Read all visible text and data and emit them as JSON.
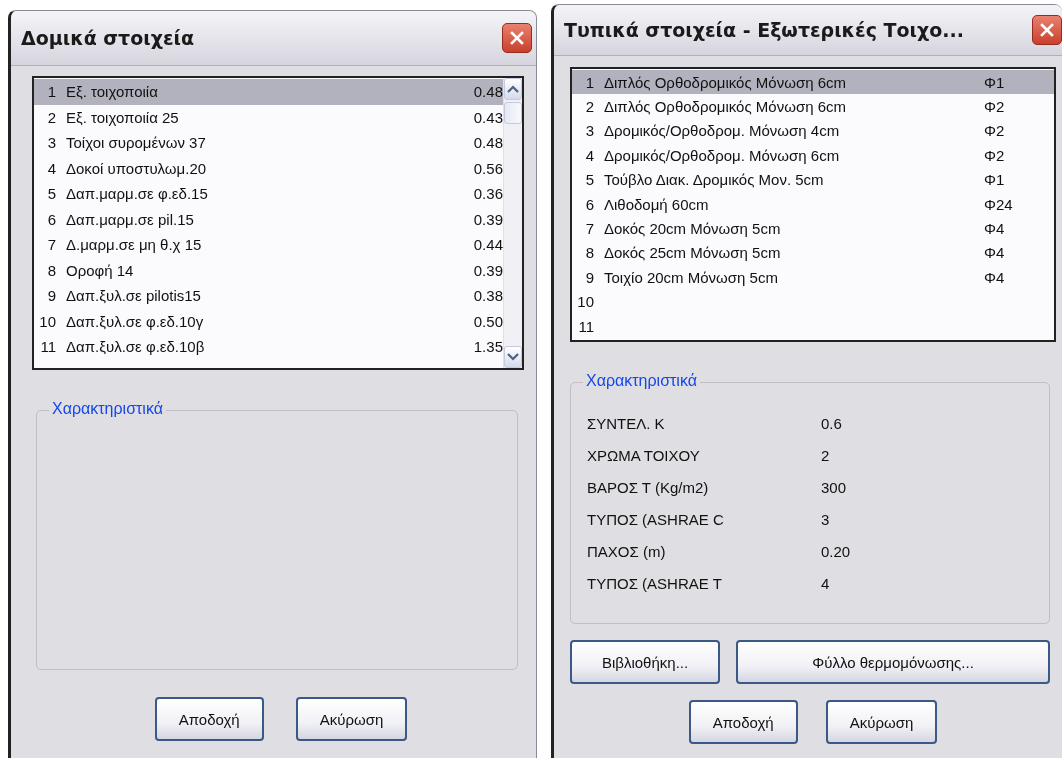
{
  "dialogs": [
    {
      "title": "Δομικά στοιχεία",
      "list": {
        "scrollbar": true,
        "rows": [
          {
            "number": "1",
            "name": "Εξ. τοιχοποιία",
            "value": "0.48",
            "selected": true
          },
          {
            "number": "2",
            "name": "Εξ. τοιχοποιία 25",
            "value": "0.43",
            "selected": false
          },
          {
            "number": "3",
            "name": "Τοίχοι συρομένων 37",
            "value": "0.48",
            "selected": false
          },
          {
            "number": "4",
            "name": "Δοκοί υποστυλωμ.20",
            "value": "0.56",
            "selected": false
          },
          {
            "number": "5",
            "name": "Δαπ.μαρμ.σε φ.εδ.15",
            "value": "0.36",
            "selected": false
          },
          {
            "number": "6",
            "name": "Δαπ.μαρμ.σε pil.15",
            "value": "0.39",
            "selected": false
          },
          {
            "number": "7",
            "name": "Δ.μαρμ.σε μη θ.χ 15",
            "value": "0.44",
            "selected": false
          },
          {
            "number": "8",
            "name": "Οροφή 14",
            "value": "0.39",
            "selected": false
          },
          {
            "number": "9",
            "name": "Δαπ.ξυλ.σε pilotis15",
            "value": "0.38",
            "selected": false
          },
          {
            "number": "10",
            "name": "Δαπ.ξυλ.σε φ.εδ.10γ",
            "value": "0.50",
            "selected": false
          },
          {
            "number": "11",
            "name": "Δαπ.ξυλ.σε φ.εδ.10β",
            "value": "1.35",
            "selected": false
          }
        ]
      },
      "characteristics": {
        "label": "Χαρακτηριστικά"
      },
      "button_rows": [
        [
          "Αποδοχή",
          "Ακύρωση"
        ]
      ]
    },
    {
      "title": "Τυπικά στοιχεία - Εξωτερικές Τοιχο...",
      "list": {
        "scrollbar": false,
        "rows": [
          {
            "number": "1",
            "name": "Διπλός Ορθοδρομικός Μόνωση 6cm",
            "value": "Φ1",
            "selected": true
          },
          {
            "number": "2",
            "name": "Διπλός Ορθοδρομικός Μόνωση 6cm",
            "value": "Φ2",
            "selected": false
          },
          {
            "number": "3",
            "name": "Δρομικός/Ορθοδρομ. Μόνωση 4cm",
            "value": "Φ2",
            "selected": false
          },
          {
            "number": "4",
            "name": "Δρομικός/Ορθοδρομ. Μόνωση 6cm",
            "value": "Φ2",
            "selected": false
          },
          {
            "number": "5",
            "name": "Τούβλο Διακ. Δρομικός Μον. 5cm",
            "value": "Φ1",
            "selected": false
          },
          {
            "number": "6",
            "name": "Λιθοδομή 60cm",
            "value": "Φ24",
            "selected": false
          },
          {
            "number": "7",
            "name": "Δοκός 20cm Μόνωση 5cm",
            "value": "Φ4",
            "selected": false
          },
          {
            "number": "8",
            "name": "Δοκός 25cm Μόνωση 5cm",
            "value": "Φ4",
            "selected": false
          },
          {
            "number": "9",
            "name": "Τοιχίο 20cm Μόνωση 5cm",
            "value": "Φ4",
            "selected": false
          },
          {
            "number": "10",
            "selected": false
          },
          {
            "number": "11",
            "selected": false
          }
        ]
      },
      "characteristics": {
        "label": "Χαρακτηριστικά",
        "properties": [
          {
            "name": "ΣΥΝΤΕΛ. K",
            "value": "0.6"
          },
          {
            "name": "ΧΡΩΜΑ ΤΟΙΧΟΥ",
            "value": "2"
          },
          {
            "name": "ΒΑΡΟΣ Τ (Kg/m2)",
            "value": "300"
          },
          {
            "name": "ΤΥΠΟΣ (ASHRAE C",
            "value": "3"
          },
          {
            "name": "ΠΑΧΟΣ (m)",
            "value": "0.20"
          },
          {
            "name": "ΤΥΠΟΣ (ASHRAE T",
            "value": "4"
          }
        ]
      },
      "button_rows": [
        [
          "Βιβλιοθήκη...",
          "Φύλλο θερμομόνωσης..."
        ],
        [
          "Αποδοχή",
          "Ακύρωση"
        ]
      ]
    }
  ]
}
